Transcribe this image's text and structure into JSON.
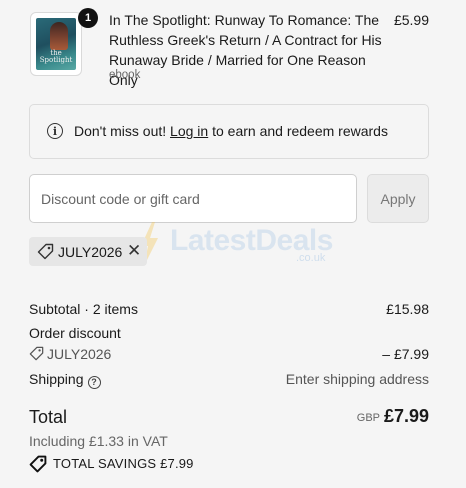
{
  "product": {
    "quantity": "1",
    "cover_text": "the Spotlight",
    "title": "In The Spotlight: Runway To Romance: The Ruthless Greek's Return / A Contract for His Runaway Bride / Married for One Reason Only",
    "type": "ebook",
    "price": "£5.99"
  },
  "banner": {
    "text_before": "Don't miss out!",
    "link": "Log in",
    "text_after": "to earn and redeem rewards"
  },
  "discount": {
    "placeholder": "Discount code or gift card",
    "apply_label": "Apply",
    "applied_code": "JULY2026"
  },
  "watermark": {
    "text": "LatestDeals",
    "sub": ".co.uk"
  },
  "summary": {
    "subtotal_label": "Subtotal · 2 items",
    "subtotal_value": "£15.98",
    "order_discount_label": "Order discount",
    "discount_code": "JULY2026",
    "discount_value": "– £7.99",
    "shipping_label": "Shipping",
    "shipping_value": "Enter shipping address",
    "total_label": "Total",
    "currency": "GBP",
    "total_value": "£7.99",
    "vat_text": "Including £1.33 in VAT",
    "savings_label": "TOTAL SAVINGS",
    "savings_value": "£7.99"
  },
  "colors": {
    "background": "#f5f5f5",
    "text": "#1a1a1a",
    "muted": "#666666",
    "watermark": "#78aadc",
    "watermark_bolt": "#f3c24a"
  }
}
